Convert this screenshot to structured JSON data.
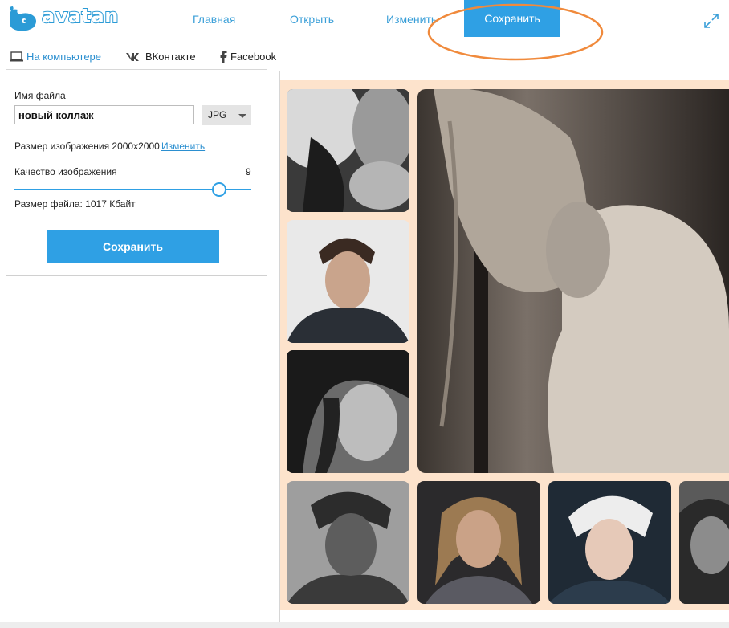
{
  "app": {
    "logo_text": "avatan"
  },
  "nav": {
    "items": [
      {
        "label": "Главная"
      },
      {
        "label": "Открыть"
      },
      {
        "label": "Изменить"
      }
    ],
    "save_label": "Сохранить"
  },
  "subtabs": [
    {
      "label": "На компьютере",
      "icon": "laptop-icon"
    },
    {
      "label": "ВКонтакте",
      "icon": "vk-icon"
    },
    {
      "label": "Facebook",
      "icon": "facebook-icon"
    }
  ],
  "panel": {
    "filename_label": "Имя файла",
    "filename_value": "новый коллаж",
    "format_value": "JPG",
    "size_label": "Размер изображения 2000x2000",
    "size_change_link": "Изменить",
    "quality_label": "Качество изображения",
    "quality_value": "9",
    "quality_level": 0.83,
    "filesize_label": "Размер файла: 1017 Кбайт",
    "save_button": "Сохранить"
  },
  "colors": {
    "accent": "#2fa0e4",
    "collage_background": "#fde3cc",
    "annotation_circle": "#f08a3c"
  }
}
